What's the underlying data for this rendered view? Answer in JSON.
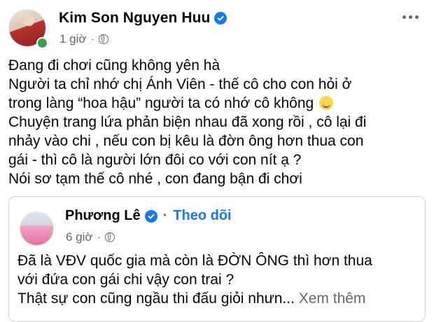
{
  "post": {
    "author": "Kim Son Nguyen Huu",
    "time": "1 giờ",
    "lines": [
      "Đang đi chơi cũng không yên hà",
      "Người ta chỉ nhớ chị Ánh Viên - thế cô cho con hỏi ở",
      "trong làng “hoa hậu” người ta có nhớ cô không",
      "Chuyện trang lứa phản biện nhau đã xong rồi , cô lại đi",
      "nhảy vào chi , nếu con bị kêu là đờn ông hơn thua con",
      "gái - thì cô là người lớn đôi co với con nít ạ ?",
      "Nói sơ tạm thế cô nhé , con đang bận đi chơi"
    ],
    "emoji_icon": "rolling-laughing-emoji"
  },
  "shared": {
    "author": "Phương Lê",
    "separator": "·",
    "follow_label": "Theo dõi",
    "time": "6 giờ",
    "lines": [
      "Đã là VĐV quốc gia mà còn là ĐỜN ÔNG thì hơn thua",
      "với đứa con gái chi vậy con trai ?"
    ],
    "truncated_line": "Thật sự con cũng ngầu thi đấu giỏi nhưn...",
    "see_more_label": "Xem thêm"
  },
  "colors": {
    "accent": "#1877f2",
    "secondary_text": "#65676b",
    "online": "#31a24c"
  }
}
